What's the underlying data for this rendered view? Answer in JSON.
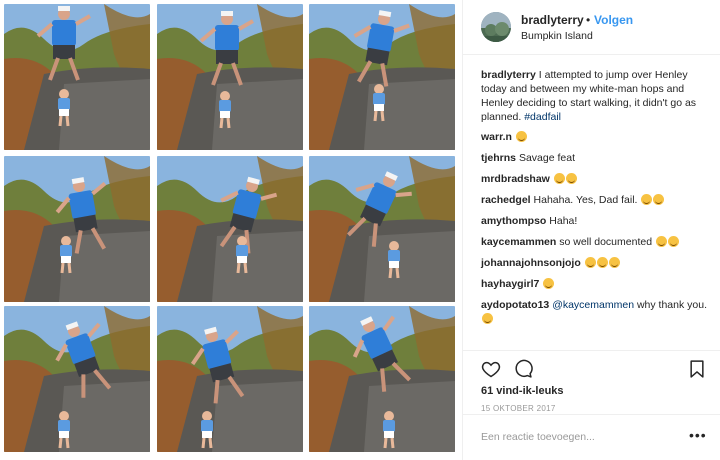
{
  "post": {
    "username": "bradlyterry",
    "separator": "•",
    "follow_label": "Volgen",
    "location": "Bumpkin Island",
    "avatar_icon": "avatar-photo",
    "caption": {
      "author": "bradlyterry",
      "text": " I attempted to jump over Henley today and between my white-man hops and Henley deciding to start walking, it didn't go as planned. ",
      "hashtag": "#dadfail"
    },
    "comments": [
      {
        "author": "warr.n",
        "text": "",
        "emoji_count": 1
      },
      {
        "author": "tjehrns",
        "text": "Savage feat",
        "emoji_count": 0
      },
      {
        "author": "mrdbradshaw",
        "text": "",
        "emoji_count": 2
      },
      {
        "author": "rachedgel",
        "text": "Hahaha. Yes, Dad fail.",
        "emoji_count": 2
      },
      {
        "author": "amythompso",
        "text": "Haha!",
        "emoji_count": 0
      },
      {
        "author": "kaycemammen",
        "text": "so well documented",
        "emoji_count": 2
      },
      {
        "author": "johannajohnsonjojo",
        "text": "",
        "emoji_count": 3
      },
      {
        "author": "hayhaygirl7",
        "text": "",
        "emoji_count": 1
      }
    ],
    "last_comment": {
      "author": "aydopotato13",
      "mention": "@kaycemammen",
      "text": " why thank you."
    },
    "likes": "61 vind-ik-leuks",
    "date": "15 OKTOBER 2017",
    "add_comment_placeholder": "Een reactie toevoegen...",
    "more_label": "•••",
    "accent_color": "#3897f0"
  }
}
